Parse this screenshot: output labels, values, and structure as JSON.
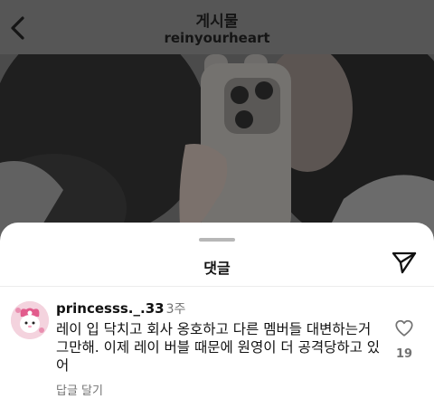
{
  "header": {
    "title": "게시물",
    "username": "reinyourheart",
    "back_icon": "chevron-left-icon"
  },
  "sheet": {
    "title": "댓글",
    "share_icon": "paper-plane-icon"
  },
  "comment": {
    "username": "princesss._.33",
    "time": "3주",
    "text": "레이 입 닥치고 회사 옹호하고 다른 멤버들 대변하는거 그만해. 이제 레이 버블 때문에 원영이 더 공격당하고 있어",
    "reply_label": "답글 달기",
    "like_count": "19",
    "like_icon": "heart-outline-icon"
  },
  "colors": {
    "overlay": "#565656",
    "sheet_bg": "#ffffff",
    "secondary_text": "#737373"
  }
}
